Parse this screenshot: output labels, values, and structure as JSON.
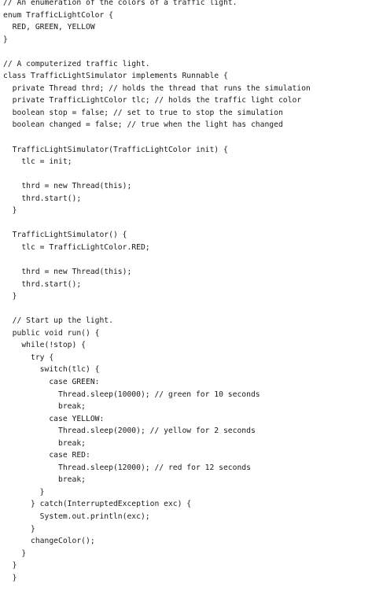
{
  "code": {
    "lines": [
      "// An enumeration of the colors of a traffic light.",
      "enum TrafficLightColor {",
      "  RED, GREEN, YELLOW",
      "}",
      "",
      "// A computerized traffic light.",
      "class TrafficLightSimulator implements Runnable {",
      "  private Thread thrd; // holds the thread that runs the simulation",
      "  private TrafficLightColor tlc; // holds the traffic light color",
      "  boolean stop = false; // set to true to stop the simulation",
      "  boolean changed = false; // true when the light has changed",
      "",
      "  TrafficLightSimulator(TrafficLightColor init) {",
      "    tlc = init;",
      "",
      "    thrd = new Thread(this);",
      "    thrd.start();",
      "  }",
      "",
      "  TrafficLightSimulator() {",
      "    tlc = TrafficLightColor.RED;",
      "",
      "    thrd = new Thread(this);",
      "    thrd.start();",
      "  }",
      "",
      "  // Start up the light.",
      "  public void run() {",
      "    while(!stop) {",
      "      try {",
      "        switch(tlc) {",
      "          case GREEN:",
      "            Thread.sleep(10000); // green for 10 seconds",
      "            break;",
      "          case YELLOW:",
      "            Thread.sleep(2000); // yellow for 2 seconds",
      "            break;",
      "          case RED:",
      "            Thread.sleep(12000); // red for 12 seconds",
      "            break;",
      "        }",
      "      } catch(InterruptedException exc) {",
      "        System.out.println(exc);",
      "      }",
      "      changeColor();",
      "    }",
      "  }",
      "  }"
    ]
  }
}
